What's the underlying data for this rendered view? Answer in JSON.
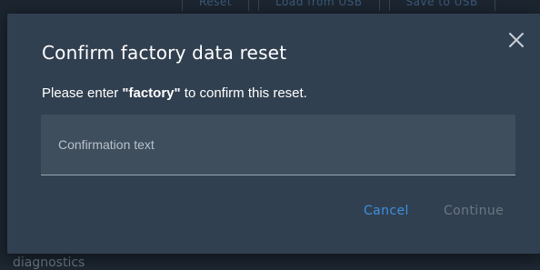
{
  "background": {
    "toolbar": [
      "Reset",
      "Load from USB",
      "Save to USB"
    ],
    "bottom_text": "diagnostics"
  },
  "dialog": {
    "title": "Confirm factory data reset",
    "message_prefix": "Please enter ",
    "message_keyword": "\"factory\"",
    "message_suffix": " to confirm this reset.",
    "input_placeholder": "Confirmation text",
    "input_value": "",
    "cancel_label": "Cancel",
    "continue_label": "Continue",
    "close_icon": "close-icon"
  },
  "colors": {
    "dialog_bg": "#314050",
    "input_bg": "#3f4e5d",
    "accent": "#3d8fe0",
    "disabled": "#6a7682"
  }
}
